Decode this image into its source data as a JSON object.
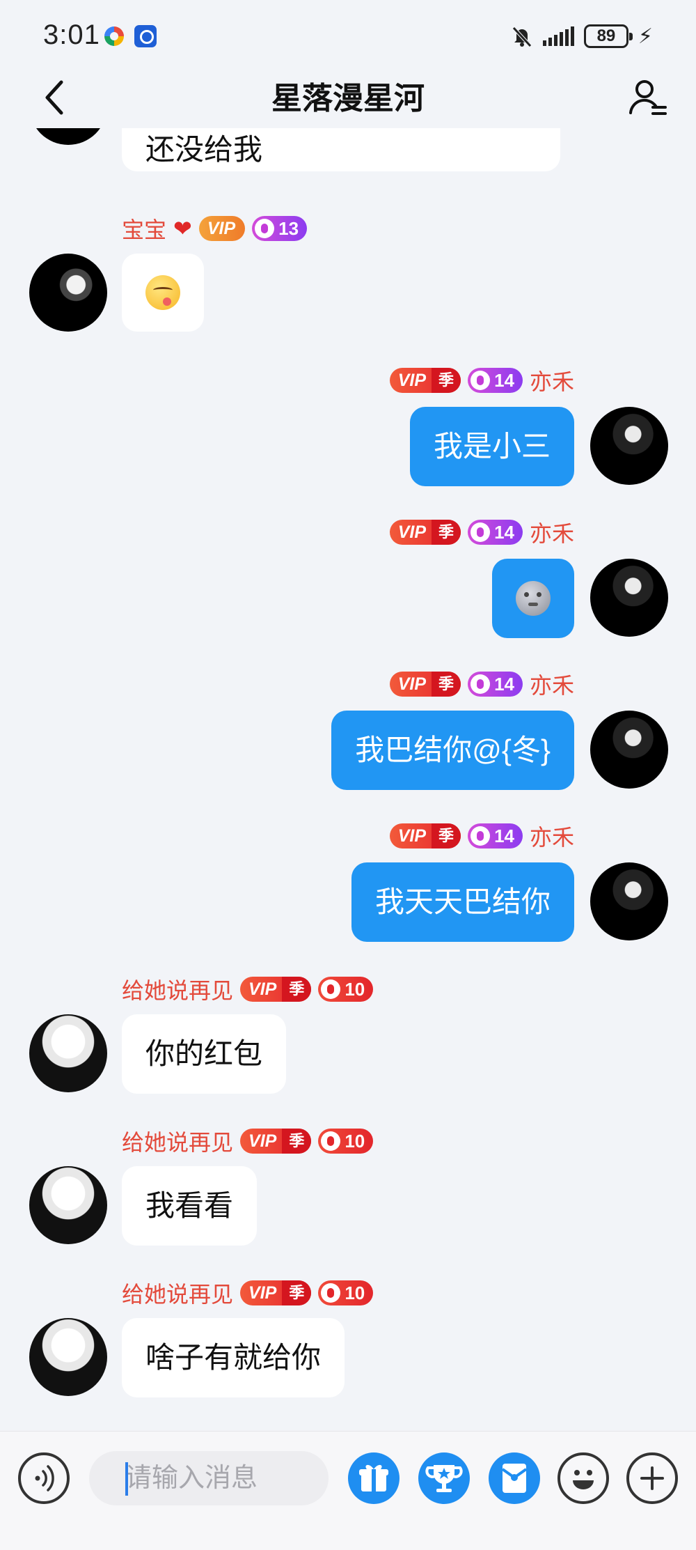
{
  "status_bar": {
    "time": "3:01",
    "battery": "89"
  },
  "header": {
    "title": "星落漫星河"
  },
  "messages": [
    {
      "direction": "in",
      "text": "还没给我"
    },
    {
      "direction": "in",
      "sender": "宝宝",
      "vip": "VIP",
      "level": "13",
      "emoji": "yum-face"
    },
    {
      "direction": "out",
      "sender": "亦禾",
      "vip": "VIP",
      "season": "季",
      "level": "14",
      "text": "我是小三"
    },
    {
      "direction": "out",
      "sender": "亦禾",
      "vip": "VIP",
      "season": "季",
      "level": "14",
      "emoji": "moon-face"
    },
    {
      "direction": "out",
      "sender": "亦禾",
      "vip": "VIP",
      "season": "季",
      "level": "14",
      "text": "我巴结你@{冬}"
    },
    {
      "direction": "out",
      "sender": "亦禾",
      "vip": "VIP",
      "season": "季",
      "level": "14",
      "text": "我天天巴结你"
    },
    {
      "direction": "in",
      "sender": "给她说再见",
      "vip": "VIP",
      "season": "季",
      "level": "10",
      "text": "你的红包"
    },
    {
      "direction": "in",
      "sender": "给她说再见",
      "vip": "VIP",
      "season": "季",
      "level": "10",
      "text": "我看看"
    },
    {
      "direction": "in",
      "sender": "给她说再见",
      "vip": "VIP",
      "season": "季",
      "level": "10",
      "text": "啥子有就给你"
    }
  ],
  "composer": {
    "placeholder": "请输入消息"
  },
  "colors": {
    "accent": "#2196f3",
    "name_red": "#e34a3b",
    "background": "#f2f4f8"
  }
}
